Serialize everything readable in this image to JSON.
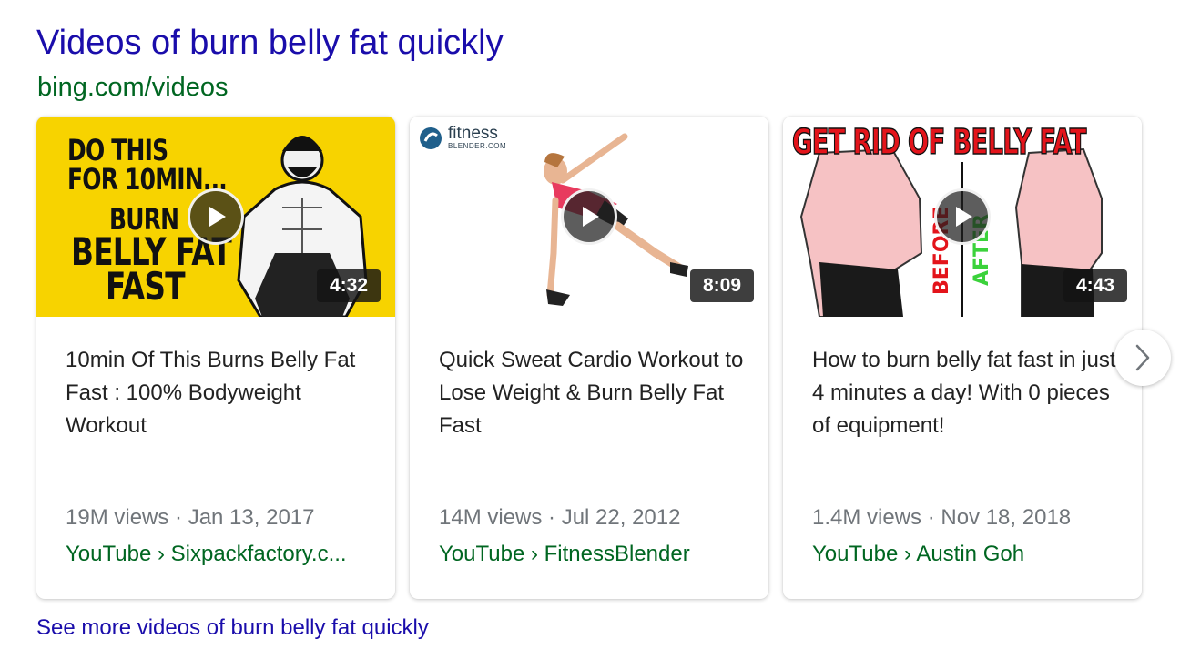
{
  "header": {
    "title": "Videos of burn belly fat quickly",
    "url": "bing.com/videos"
  },
  "videos": [
    {
      "thumbnail_text": [
        "DO THIS",
        "FOR 10MIN...",
        "BURN",
        "BELLY FAT",
        "FAST"
      ],
      "duration": "4:32",
      "title": "10min Of This Burns Belly Fat Fast : 100% Bodyweight Workout",
      "meta": "19M views · Jan 13, 2017",
      "source": "YouTube › Sixpackfactory.c..."
    },
    {
      "thumbnail_logo": "fitness",
      "thumbnail_logo_sub": "BLENDER.COM",
      "duration": "8:09",
      "title": "Quick Sweat Cardio Workout to Lose Weight & Burn Belly Fat Fast",
      "meta": "14M views · Jul 22, 2012",
      "source": "YouTube › FitnessBlender"
    },
    {
      "thumbnail_banner": "GET RID OF BELLY FAT",
      "thumbnail_before": "BEFORE",
      "thumbnail_after": "AFTER",
      "duration": "4:43",
      "title": "How to burn belly fat fast in just 4 minutes a day! With 0 pieces of equipment!",
      "meta": "1.4M views · Nov 18, 2018",
      "source": "YouTube › Austin Goh"
    }
  ],
  "see_more": "See more videos of burn belly fat quickly",
  "icons": {
    "play": "play-icon",
    "next": "chevron-right-icon",
    "logo": "fitness-blender-logo-icon"
  },
  "colors": {
    "link": "#1a0dab",
    "url": "#006621",
    "meta": "#70757a",
    "thumb1_bg": "#f7d300"
  }
}
